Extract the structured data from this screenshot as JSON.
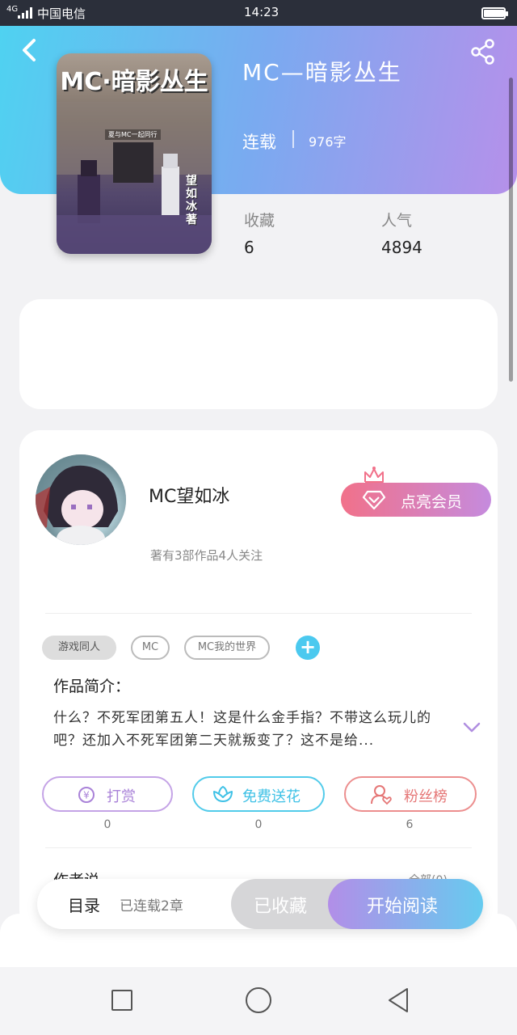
{
  "status_bar": {
    "network": "4G",
    "carrier": "中国电信",
    "time": "14:23",
    "battery_level": 0.95
  },
  "book": {
    "cover_title": "MC·暗影丛生",
    "cover_subtitle": "夏与MC一起同行",
    "cover_author": "望如冰著",
    "title": "MC—暗影丛生",
    "status": "连载",
    "word_count": "976字",
    "favorites_label": "收藏",
    "favorites_value": "6",
    "popularity_label": "人气",
    "popularity_value": "4894"
  },
  "author": {
    "name": "MC望如冰",
    "meta": "著有3部作品4人关注",
    "vip_button": "点亮会员"
  },
  "tags": [
    "游戏同人",
    "MC",
    "MC我的世界"
  ],
  "intro": {
    "title": "作品简介：",
    "text": "什么？不死军团第五人！这是什么金手指？不带这么玩儿的吧？还加入不死军团第二天就叛变了？这不是给..."
  },
  "actions": {
    "tip_label": "打赏",
    "tip_count": "0",
    "flower_label": "免费送花",
    "flower_count": "0",
    "fans_label": "粉丝榜",
    "fans_count": "6"
  },
  "author_says": {
    "title": "作者说",
    "all_link": "全部(0)"
  },
  "bottom_bar": {
    "toc": "目录",
    "chapters": "已连载2章",
    "collected": "已收藏",
    "start_reading": "开始阅读"
  },
  "colors": {
    "header_gradient_start": "#4fd2f1",
    "header_gradient_end": "#b690ea",
    "accent_blue": "#4bc9ef",
    "accent_purple": "#b28ee8",
    "vip_pink": "#f1718a"
  }
}
